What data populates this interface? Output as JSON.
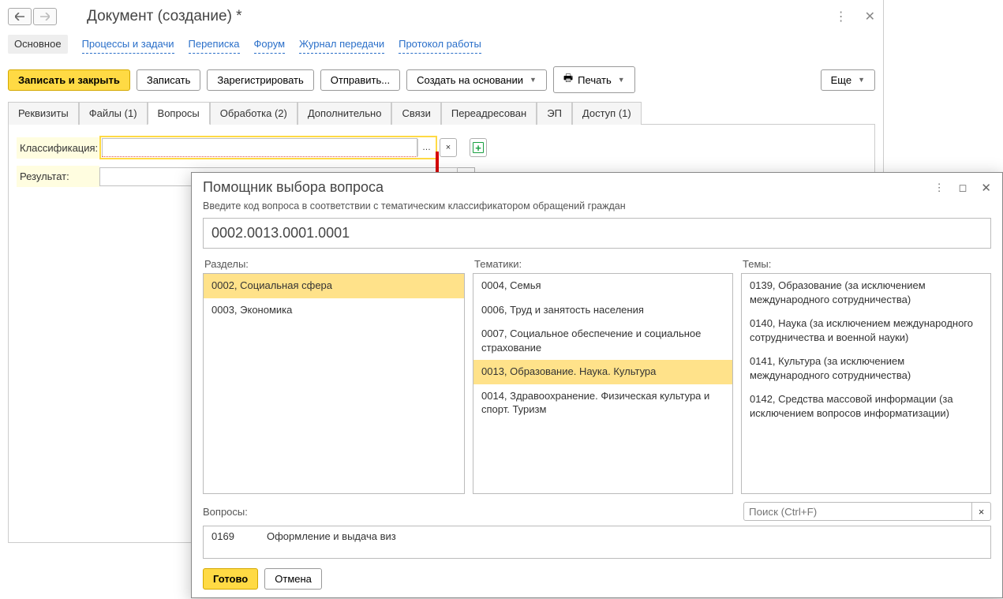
{
  "header": {
    "title": "Документ (создание) *"
  },
  "nav": {
    "main": "Основное",
    "processes": "Процессы и задачи",
    "correspondence": "Переписка",
    "forum": "Форум",
    "journal": "Журнал передачи",
    "protocol": "Протокол работы"
  },
  "toolbar": {
    "save_close": "Записать и закрыть",
    "save": "Записать",
    "register": "Зарегистрировать",
    "send": "Отправить...",
    "create_based": "Создать на основании",
    "print": "Печать",
    "more": "Еще"
  },
  "subtabs": {
    "requisites": "Реквизиты",
    "files": "Файлы (1)",
    "questions": "Вопросы",
    "processing": "Обработка (2)",
    "additional": "Дополнительно",
    "links": "Связи",
    "forwarded": "Переадресован",
    "ep": "ЭП",
    "access": "Доступ (1)"
  },
  "form": {
    "classification_label": "Классификация:",
    "result_label": "Результат:"
  },
  "dialog": {
    "title": "Помощник выбора вопроса",
    "hint": "Введите код вопроса в соответствии с тематическим классификатором обращений граждан",
    "code_value": "0002.0013.0001.0001",
    "sections_label": "Разделы:",
    "topics_label": "Тематики:",
    "themes_label": "Темы:",
    "questions_label": "Вопросы:",
    "search_placeholder": "Поиск (Ctrl+F)",
    "sections": [
      "0002, Социальная сфера",
      "0003, Экономика"
    ],
    "topics": [
      "0004, Семья",
      "0006, Труд и занятость населения",
      "0007, Социальное обеспечение и социальное страхование",
      "0013, Образование. Наука. Культура",
      "0014, Здравоохранение. Физическая культура и спорт. Туризм"
    ],
    "themes": [
      "0139, Образование (за исключением международного сотрудничества)",
      "0140, Наука (за исключением международного сотрудничества и военной науки)",
      "0141, Культура (за исключением международного сотрудничества)",
      "0142, Средства массовой информации (за исключением вопросов информатизации)"
    ],
    "question_rows": [
      {
        "code": "0169",
        "text": "Оформление и выдача виз"
      }
    ],
    "done": "Готово",
    "cancel": "Отмена"
  }
}
